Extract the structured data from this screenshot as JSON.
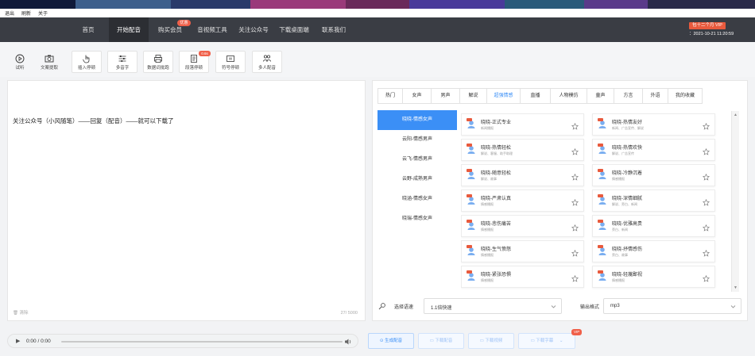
{
  "menubar": {
    "items": [
      "退出",
      "刷新",
      "关于"
    ]
  },
  "nav": {
    "items": [
      "首页",
      "开始配音",
      "购买会员",
      "音视频工具",
      "关注公众号",
      "下载桌面端",
      "联系我们"
    ],
    "active_index": 1,
    "hot_badge": "优惠",
    "vip_badge": "包十二个月 VIP",
    "vip_date": "：2021-10-21 11:20:59"
  },
  "toolbar": {
    "items": [
      {
        "label": "试听",
        "icon": "play-circle-icon"
      },
      {
        "label": "文案提取",
        "icon": "camera-icon"
      },
      {
        "label": "插入停顿",
        "icon": "hand-pointer-icon"
      },
      {
        "label": "多音字",
        "icon": "sliders-icon"
      },
      {
        "label": "数据词批跑",
        "icon": "printer-icon"
      },
      {
        "label": "段落停顿",
        "icon": "document-icon"
      },
      {
        "label": "符号停顿",
        "icon": "pause-box-icon"
      },
      {
        "label": "多人配音",
        "icon": "people-icon"
      }
    ],
    "badge": "0.6s"
  },
  "editor": {
    "text": "关注公众号（小风随笔）——回复（配音）——就可以下载了",
    "clear_label": "清除",
    "count": "27/ 5000"
  },
  "voice_panel": {
    "tabs": [
      "热门",
      "女声",
      "男声",
      "解说",
      "超强情感",
      "直播",
      "人物模仿",
      "童声",
      "方言",
      "外语",
      "我的收藏"
    ],
    "active_tab": 4,
    "categories": [
      "晓晓-情感女声",
      "云阳-情感男声",
      "云飞-情感男声",
      "云野-成熟男声",
      "晓涵-情感女声",
      "晓瑞-情感女声"
    ],
    "active_category": 0,
    "voices": [
      {
        "name": "晓晓-正式专业",
        "tags": "新闻播报"
      },
      {
        "name": "晓晓-热情友好",
        "tags": "新闻、广告宣传、解说"
      },
      {
        "name": "晓晓-热情轻松",
        "tags": "解说、客服、助手助理"
      },
      {
        "name": "晓晓-热情欢快",
        "tags": "解说、广告宣传"
      },
      {
        "name": "晓晓-随意轻松",
        "tags": "解说、故事"
      },
      {
        "name": "晓晓-冷静沉着",
        "tags": "情感播报"
      },
      {
        "name": "晓晓-严肃认真",
        "tags": "情感播报"
      },
      {
        "name": "晓晓-深情细腻",
        "tags": "解说、旁白、新闻"
      },
      {
        "name": "晓晓-悲伤痛苦",
        "tags": "情感播报"
      },
      {
        "name": "晓晓-优雅高贵",
        "tags": "旁白、新闻"
      },
      {
        "name": "晓晓-生气愤怒",
        "tags": "情感播报"
      },
      {
        "name": "晓晓-抒情感伤",
        "tags": "旁白、故事"
      },
      {
        "name": "晓晓-紧张恐惧",
        "tags": "情感播报"
      },
      {
        "name": "晓晓-轻蔑鄙视",
        "tags": "情感播报"
      }
    ],
    "speed_label": "选择语速",
    "speed_value": "1.1倍快速",
    "format_label": "输出格式",
    "format_value": "mp3"
  },
  "player": {
    "time": "0:00 / 0:00"
  },
  "actions": {
    "generate": "生成配音",
    "download_audio": "下载配音",
    "download_video": "下载视频",
    "download_subtitle": "下载字幕",
    "vip_badge": "VIP"
  },
  "colors": {
    "accent": "#3b8ff6",
    "nav_bg": "#3a3d44",
    "badge_red": "#f0604a"
  }
}
